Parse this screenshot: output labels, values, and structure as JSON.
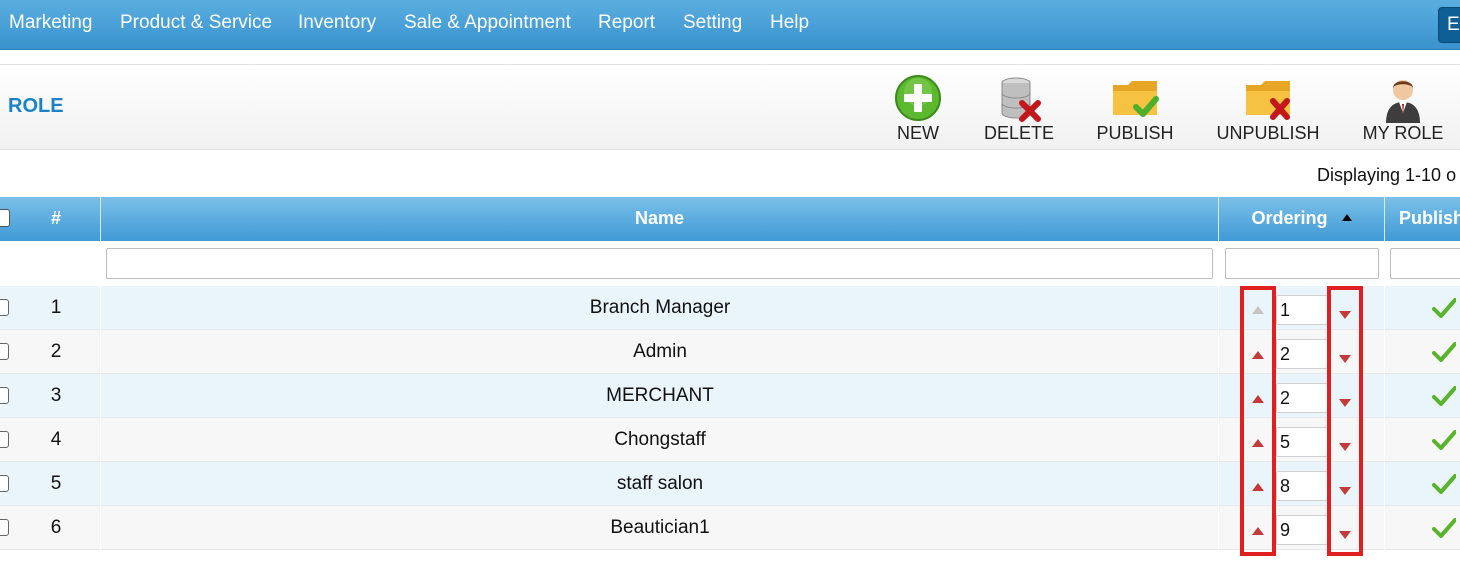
{
  "nav": {
    "items": [
      "Marketing",
      "Product & Service",
      "Inventory",
      "Sale & Appointment",
      "Report",
      "Setting",
      "Help"
    ],
    "language_button": "En"
  },
  "page": {
    "title": "ROLE"
  },
  "toolbar": {
    "new_label": "NEW",
    "delete_label": "DELETE",
    "publish_label": "PUBLISH",
    "unpublish_label": "UNPUBLISH",
    "my_role_label": "MY ROLE"
  },
  "pagination": {
    "displaying": "Displaying 1-10 o"
  },
  "grid": {
    "columns": {
      "number": "#",
      "name": "Name",
      "ordering": "Ordering",
      "publish": "Publish"
    },
    "sort": {
      "column": "ordering",
      "direction": "ascending"
    },
    "rows": [
      {
        "number": "1",
        "name": "Branch Manager",
        "ordering": "1",
        "published": true,
        "up_disabled": true
      },
      {
        "number": "2",
        "name": "Admin",
        "ordering": "2",
        "published": true,
        "up_disabled": false
      },
      {
        "number": "3",
        "name": "MERCHANT",
        "ordering": "2",
        "published": true,
        "up_disabled": false
      },
      {
        "number": "4",
        "name": "Chongstaff",
        "ordering": "5",
        "published": true,
        "up_disabled": false
      },
      {
        "number": "5",
        "name": "staff salon",
        "ordering": "8",
        "published": true,
        "up_disabled": false
      },
      {
        "number": "6",
        "name": "Beautician1",
        "ordering": "9",
        "published": true,
        "up_disabled": false
      }
    ]
  },
  "colors": {
    "nav_bg": "#3a93cf",
    "title": "#1a83c8",
    "header_bg": "#4fa4da",
    "odd_row": "#eaf4fb",
    "even_row": "#f7f7f7",
    "arrow": "#c43a3a",
    "highlight": "#e02020",
    "publish_check": "#59b42c"
  }
}
